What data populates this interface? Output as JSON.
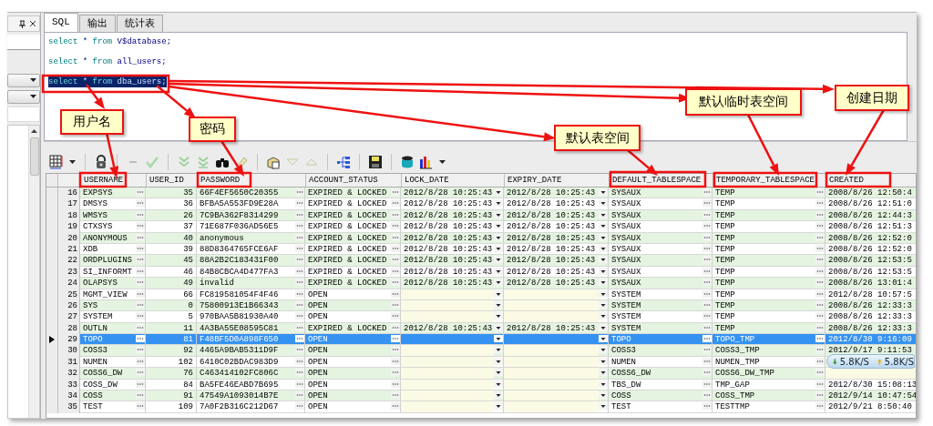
{
  "tabs": [
    {
      "label": "SQL",
      "selected": true
    },
    {
      "label": "输出",
      "selected": false
    },
    {
      "label": "统计表",
      "selected": false
    }
  ],
  "sql_lines": [
    {
      "selected": false,
      "tokens": [
        {
          "text": "select",
          "kind": "keyword"
        },
        {
          "text": " * ",
          "kind": "other"
        },
        {
          "text": "from",
          "kind": "keyword"
        },
        {
          "text": " V$database;",
          "kind": "other"
        }
      ]
    },
    {
      "selected": false,
      "tokens": [
        {
          "text": "select",
          "kind": "keyword"
        },
        {
          "text": " * ",
          "kind": "other"
        },
        {
          "text": "from",
          "kind": "keyword"
        },
        {
          "text": " all_users;",
          "kind": "other"
        }
      ]
    },
    {
      "selected": true,
      "tokens": [
        {
          "text": "select",
          "kind": "keyword"
        },
        {
          "text": " * ",
          "kind": "other"
        },
        {
          "text": "from",
          "kind": "keyword"
        },
        {
          "text": " dba_users;",
          "kind": "other"
        }
      ]
    }
  ],
  "grid": {
    "columns": [
      {
        "label": "USERNAME",
        "kind": "text"
      },
      {
        "label": "USER_ID",
        "kind": "number"
      },
      {
        "label": "PASSWORD",
        "kind": "text"
      },
      {
        "label": "ACCOUNT_STATUS",
        "kind": "text"
      },
      {
        "label": "LOCK_DATE",
        "kind": "date"
      },
      {
        "label": "EXPIRY_DATE",
        "kind": "date"
      },
      {
        "label": "DEFAULT_TABLESPACE",
        "kind": "text"
      },
      {
        "label": "TEMPORARY_TABLESPACE",
        "kind": "text"
      },
      {
        "label": "CREATED",
        "kind": "plain"
      }
    ],
    "rows": [
      {
        "number": "16",
        "selected": false,
        "cells": [
          "EXPSYS",
          "35",
          "66F4EF5650C20355",
          "EXPIRED & LOCKED",
          "2012/8/28 10:25:43",
          "2012/8/28 10:25:43",
          "SYSAUX",
          "TEMP",
          "2008/8/26 12:50:4"
        ]
      },
      {
        "number": "17",
        "selected": false,
        "cells": [
          "DMSYS",
          "36",
          "BFBA5A553FD9E28A",
          "EXPIRED & LOCKED",
          "2012/8/28 10:25:43",
          "2012/8/28 10:25:43",
          "SYSAUX",
          "TEMP",
          "2008/8/26 12:51:0"
        ]
      },
      {
        "number": "18",
        "selected": false,
        "cells": [
          "WMSYS",
          "26",
          "7C9BA362F8314299",
          "EXPIRED & LOCKED",
          "2012/8/28 10:25:43",
          "2012/8/28 10:25:43",
          "SYSAUX",
          "TEMP",
          "2008/8/26 12:44:3"
        ]
      },
      {
        "number": "19",
        "selected": false,
        "cells": [
          "CTXSYS",
          "37",
          "71E687F036AD56E5",
          "EXPIRED & LOCKED",
          "2012/8/28 10:25:43",
          "2012/8/28 10:25:43",
          "SYSAUX",
          "TEMP",
          "2008/8/26 12:51:3"
        ]
      },
      {
        "number": "20",
        "selected": false,
        "cells": [
          "ANONYMOUS",
          "40",
          "anonymous",
          "EXPIRED & LOCKED",
          "2012/8/28 10:25:43",
          "2012/8/28 10:25:43",
          "SYSAUX",
          "TEMP",
          "2008/8/26 12:52:0"
        ]
      },
      {
        "number": "21",
        "selected": false,
        "cells": [
          "XDB",
          "39",
          "88D8364765FCE6AF",
          "EXPIRED & LOCKED",
          "2012/8/28 10:25:43",
          "2012/8/28 10:25:43",
          "SYSAUX",
          "TEMP",
          "2008/8/26 12:52:0"
        ]
      },
      {
        "number": "22",
        "selected": false,
        "cells": [
          "ORDPLUGINS",
          "45",
          "88A2B2C183431F00",
          "EXPIRED & LOCKED",
          "2012/8/28 10:25:43",
          "2012/8/28 10:25:43",
          "SYSAUX",
          "TEMP",
          "2008/8/26 12:53:5"
        ]
      },
      {
        "number": "23",
        "selected": false,
        "cells": [
          "SI_INFORMT",
          "46",
          "84B8CBCA4D477FA3",
          "EXPIRED & LOCKED",
          "2012/8/28 10:25:43",
          "2012/8/28 10:25:43",
          "SYSAUX",
          "TEMP",
          "2008/8/26 12:53:5"
        ]
      },
      {
        "number": "24",
        "selected": false,
        "cells": [
          "OLAPSYS",
          "49",
          "invalid",
          "EXPIRED & LOCKED",
          "2012/8/28 10:25:43",
          "2012/8/28 10:25:43",
          "SYSAUX",
          "TEMP",
          "2008/8/26 13:01:4"
        ]
      },
      {
        "number": "25",
        "selected": false,
        "cells": [
          "MGMT_VIEW",
          "66",
          "FC819581054F4F46",
          "OPEN",
          null,
          null,
          "SYSTEM",
          "TEMP",
          "2012/8/28 10:57:5"
        ]
      },
      {
        "number": "26",
        "selected": false,
        "cells": [
          "SYS",
          "0",
          "75800913E1B66343",
          "OPEN",
          null,
          null,
          "SYSTEM",
          "TEMP",
          "2008/8/26 12:33:3"
        ]
      },
      {
        "number": "27",
        "selected": false,
        "cells": [
          "SYSTEM",
          "5",
          "970BAA5B81930A40",
          "OPEN",
          null,
          null,
          "SYSTEM",
          "TEMP",
          "2008/8/26 12:33:3"
        ]
      },
      {
        "number": "28",
        "selected": false,
        "cells": [
          "OUTLN",
          "11",
          "4A3BA55E08595C81",
          "EXPIRED & LOCKED",
          "2012/8/28 10:25:43",
          "2012/8/28 10:25:43",
          "SYSTEM",
          "TEMP",
          "2008/8/26 12:33:3"
        ]
      },
      {
        "number": "29",
        "selected": true,
        "cells": [
          "TOPO",
          "81",
          "F48BF5D0A898F650",
          "OPEN",
          null,
          null,
          "TOPO",
          "TOPO_TMP",
          "2012/8/30 9:16:09"
        ]
      },
      {
        "number": "30",
        "selected": false,
        "cells": [
          "COSS3",
          "92",
          "4465A9BAB5311D9F",
          "OPEN",
          null,
          null,
          "COSS3",
          "COSS3_TMP",
          "2012/9/17 9:11:53"
        ]
      },
      {
        "number": "31",
        "selected": false,
        "cells": [
          "NUMEN",
          "102",
          "6410C02BDAC983D9",
          "OPEN",
          null,
          null,
          "NUMEN",
          "NUMEN_TMP",
          null
        ]
      },
      {
        "number": "32",
        "selected": false,
        "cells": [
          "COSS6_DW",
          "76",
          "C463414102FC806C",
          "OPEN",
          null,
          null,
          "COSS6_DW",
          "COSS6_DW_TMP",
          null
        ]
      },
      {
        "number": "33",
        "selected": false,
        "cells": [
          "COSS_DW",
          "84",
          "BA5FE46EABD7B695",
          "OPEN",
          null,
          null,
          "TBS_DW",
          "TMP_GAP",
          "2012/8/30 15:08:13"
        ]
      },
      {
        "number": "34",
        "selected": false,
        "cells": [
          "COSS",
          "91",
          "47549A1093014B7E",
          "OPEN",
          null,
          null,
          "COSS",
          "COSS_TMP",
          "2012/9/14 10:47:54"
        ]
      },
      {
        "number": "35",
        "selected": false,
        "cells": [
          "TEST",
          "109",
          "7A0F2B316C212D67",
          "OPEN",
          null,
          null,
          "TEST",
          "TESTTMP",
          "2012/9/21 8:50:40"
        ]
      }
    ]
  },
  "callouts": [
    {
      "text": "用户名"
    },
    {
      "text": "密码"
    },
    {
      "text": "默认表空间"
    },
    {
      "text": "默认临时表空间"
    },
    {
      "text": "创建日期"
    }
  ],
  "speed_widget": {
    "download": "5.8K/S",
    "upload": "5.8K/S"
  }
}
